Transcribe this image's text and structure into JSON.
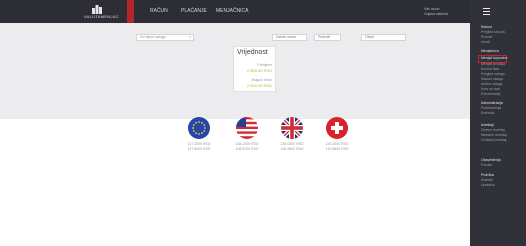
{
  "header": {
    "brand": "VALUTAMENJAC",
    "nav": [
      "RAČUN",
      "PLAĆANJE",
      "MENJAČNICA"
    ],
    "account": {
      "line1": "Vaš račun",
      "line2": "Odjava sistema"
    }
  },
  "sidebar": {
    "sections": [
      {
        "title": "Računi",
        "items": [
          "Pregled računa",
          "Promet",
          "Izvodi"
        ]
      },
      {
        "title": "Menjačnica",
        "items": [
          "Menjač kupovina",
          "Menjač prodaja",
          "Kursna lista",
          "Pregled naloga",
          "Statusi naloga",
          "Arhiva naloga",
          "Kurs na dan",
          "Preuzimanje"
        ]
      },
      {
        "title": "Administracija",
        "items": [
          "Podešavanja",
          "Korisnici"
        ]
      },
      {
        "title": "Izveštaji",
        "items": [
          "Dnevni izveštaj",
          "Mesečni izveštaj",
          "Godišnji izveštaj"
        ]
      },
      {
        "title": "Obaveštenja",
        "items": [
          "Poruke"
        ]
      },
      {
        "title": "Podrška",
        "items": [
          "Kontakt",
          "Uputstvo"
        ]
      }
    ],
    "active_item": "Menjač kupovina"
  },
  "filters": {
    "select_value": "Svi tipovi naloga",
    "btn1": "Datum od/do",
    "btn2": "Pretraži",
    "btn3": "Očisti"
  },
  "card": {
    "title": "Vrijednost",
    "row1_label": "Primljeno",
    "row1_value": "2.500.00 RSD",
    "row2_label": "Mogući iznos",
    "row2_value": "2.500.00 RSD"
  },
  "currencies": [
    {
      "name": "EUR",
      "buy": "117.2000 RSD",
      "sell": "117.8000 RSD"
    },
    {
      "name": "USD",
      "buy": "108.2300 RSD",
      "sell": "108.8700 RSD"
    },
    {
      "name": "GBP",
      "buy": "136.0200 RSD",
      "sell": "136.9800 RSD"
    },
    {
      "name": "CHF",
      "buy": "120.2000 RSD",
      "sell": "120.8600 RSD"
    }
  ],
  "colors": {
    "topbar": "#2d2d35",
    "accent": "#b3262e",
    "sidebar": "#313139",
    "value": "#9cc23c"
  }
}
